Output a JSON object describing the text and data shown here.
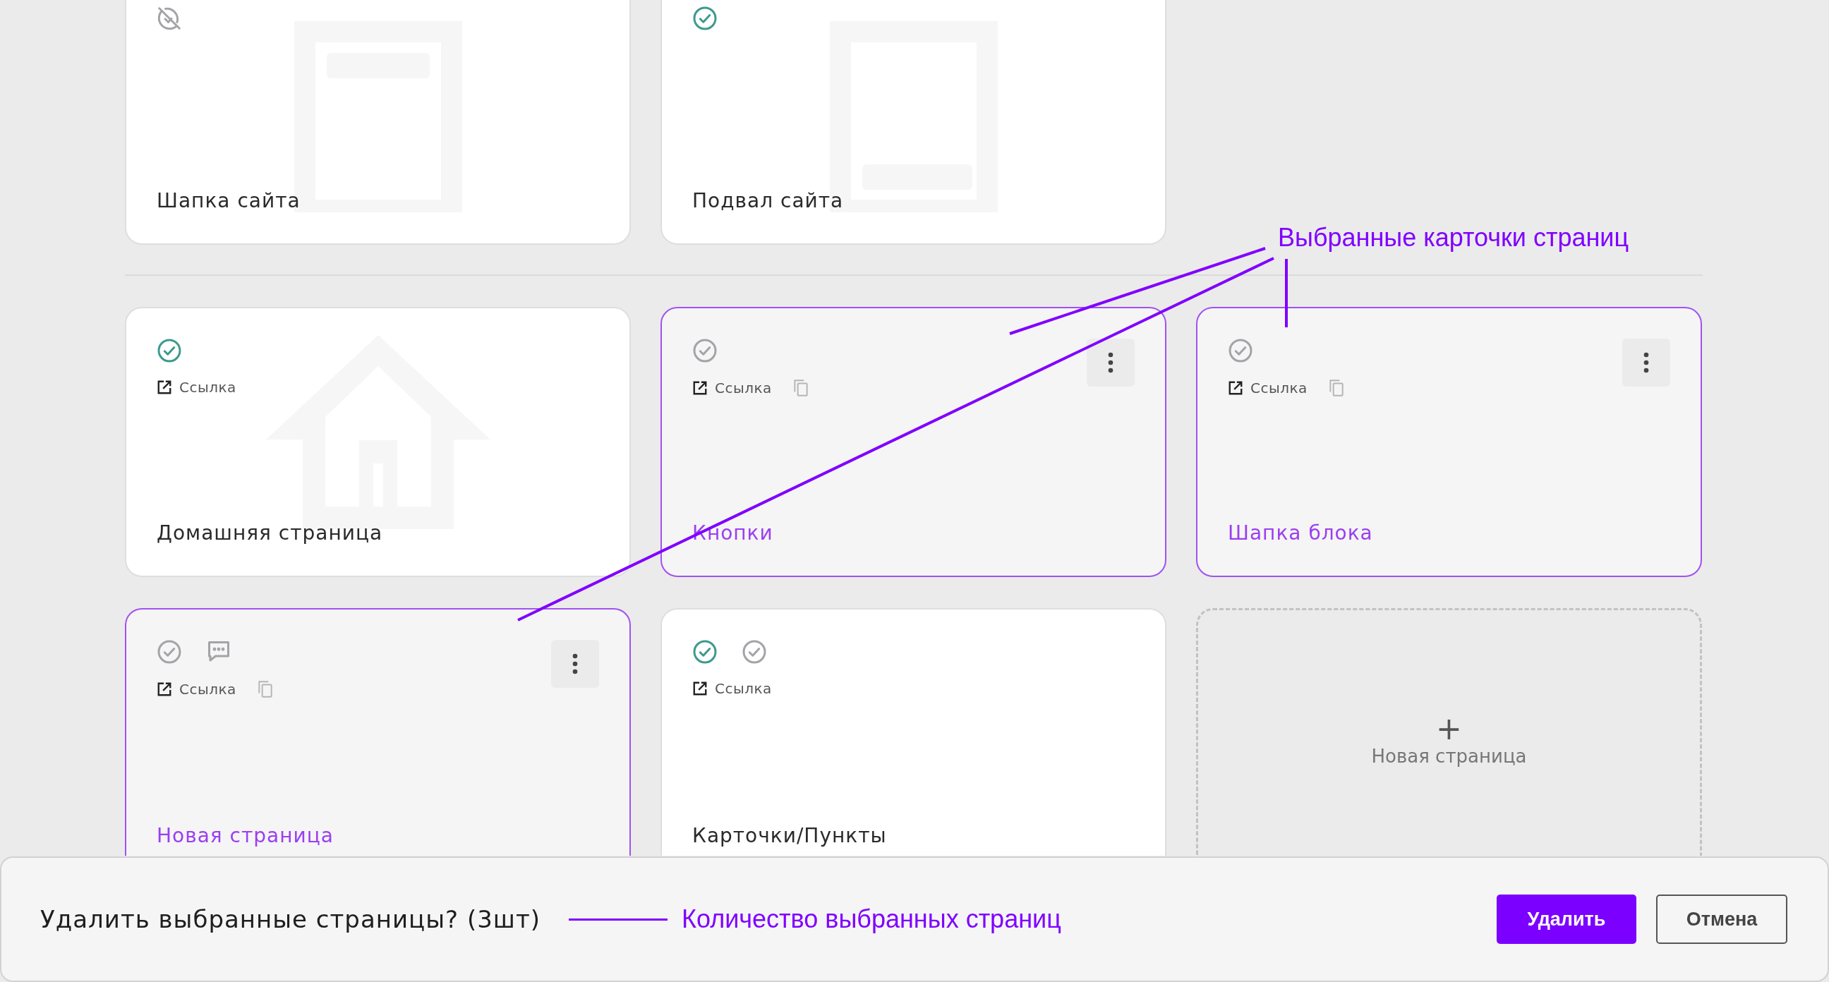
{
  "templates": [
    {
      "title": "Шапка сайта",
      "selected": false,
      "kind": "header",
      "status_icons": [
        {
          "kind": "hidden"
        }
      ]
    },
    {
      "title": "Подвал сайта",
      "selected": false,
      "kind": "footer",
      "status_icons": [
        {
          "kind": "published"
        }
      ]
    }
  ],
  "pages": [
    {
      "title": "Домашняя страница",
      "selected": false,
      "kind": "home",
      "link": "Ссылка",
      "status_icons": [
        {
          "kind": "published"
        }
      ]
    },
    {
      "title": "Кнопки",
      "selected": true,
      "link": "Ссылка",
      "status_icons": [
        {
          "kind": "draft"
        }
      ]
    },
    {
      "title": "Шапка блока",
      "selected": true,
      "link": "Ссылка",
      "status_icons": [
        {
          "kind": "draft"
        }
      ]
    },
    {
      "title": "Новая страница",
      "selected": true,
      "link": "Ссылка",
      "status_icons": [
        {
          "kind": "draft"
        },
        {
          "kind": "comment"
        }
      ]
    },
    {
      "title": "Карточки/Пункты",
      "selected": false,
      "link": "Ссылка",
      "status_icons": [
        {
          "kind": "published"
        },
        {
          "kind": "draft"
        }
      ]
    }
  ],
  "new_page": {
    "icon": "+",
    "label": "Новая страница"
  },
  "annotation": {
    "text": "Выбранные карточки страниц"
  },
  "delete_bar": {
    "question": "Удалить выбранные страницы? (3шт)",
    "annotation": "Количество выбранных страниц",
    "buttons": [
      {
        "label": "Удалить",
        "kind": "primary"
      },
      {
        "label": "Отмена",
        "kind": "secondary"
      }
    ]
  }
}
